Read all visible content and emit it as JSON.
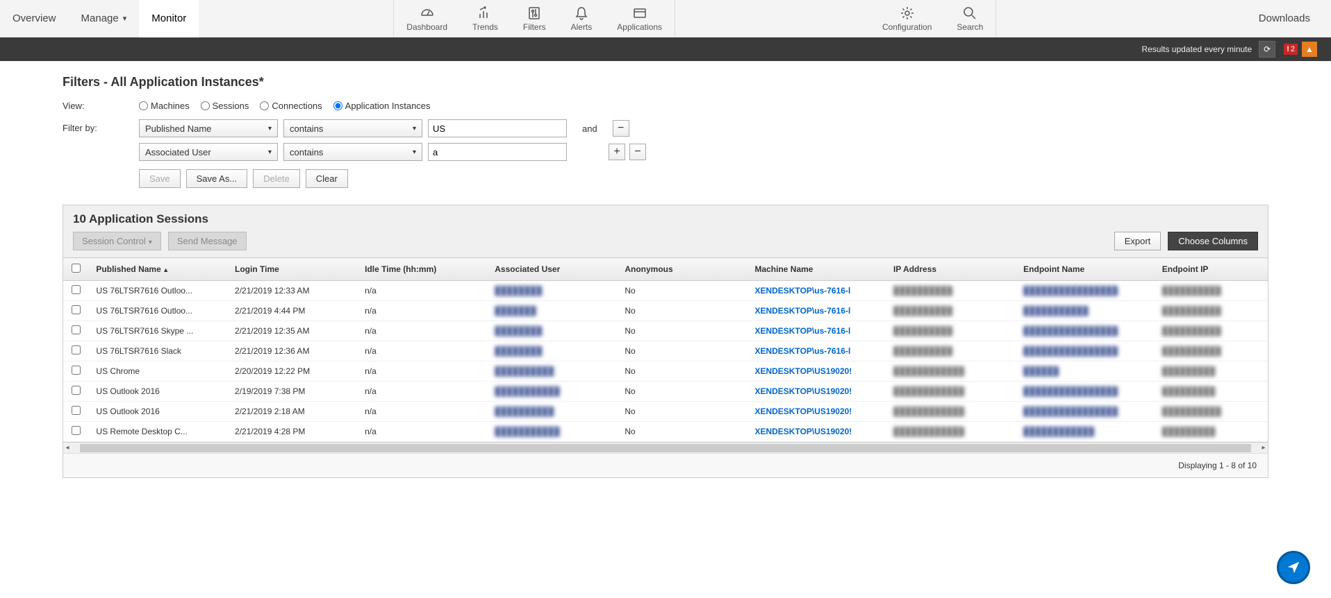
{
  "nav": {
    "overview": "Overview",
    "manage": "Manage",
    "monitor": "Monitor",
    "tools": {
      "dashboard": "Dashboard",
      "trends": "Trends",
      "filters": "Filters",
      "alerts": "Alerts",
      "applications": "Applications",
      "configuration": "Configuration",
      "search": "Search"
    },
    "downloads": "Downloads"
  },
  "darkbar": {
    "status": "Results updated every minute",
    "badge_count": "2"
  },
  "page": {
    "title": "Filters - All Application Instances*",
    "view_label": "View:",
    "radios": {
      "machines": "Machines",
      "sessions": "Sessions",
      "connections": "Connections",
      "app_instances": "Application Instances"
    },
    "filter_by_label": "Filter by:",
    "filters": [
      {
        "field": "Published Name",
        "op": "contains",
        "value": "US"
      },
      {
        "field": "Associated User",
        "op": "contains",
        "value": "a"
      }
    ],
    "and_label": "and",
    "buttons": {
      "save": "Save",
      "save_as": "Save As...",
      "delete": "Delete",
      "clear": "Clear"
    }
  },
  "results": {
    "title": "10 Application Sessions",
    "session_control": "Session Control",
    "send_message": "Send Message",
    "export": "Export",
    "choose_columns": "Choose Columns",
    "columns": [
      "Published Name",
      "Login Time",
      "Idle Time (hh:mm)",
      "Associated User",
      "Anonymous",
      "Machine Name",
      "IP Address",
      "Endpoint Name",
      "Endpoint IP"
    ],
    "rows": [
      {
        "pn": "US 76LTSR7616 Outloo...",
        "login": "2/21/2019 12:33 AM",
        "idle": "n/a",
        "user": "████████",
        "anon": "No",
        "machine": "XENDESKTOP\\us-7616-l",
        "ip": "██████████",
        "ep": "████████████████",
        "epip": "██████████"
      },
      {
        "pn": "US 76LTSR7616 Outloo...",
        "login": "2/21/2019 4:44 PM",
        "idle": "n/a",
        "user": "███████",
        "anon": "No",
        "machine": "XENDESKTOP\\us-7616-l",
        "ip": "██████████",
        "ep": "███████████",
        "epip": "██████████"
      },
      {
        "pn": "US 76LTSR7616 Skype ...",
        "login": "2/21/2019 12:35 AM",
        "idle": "n/a",
        "user": "████████",
        "anon": "No",
        "machine": "XENDESKTOP\\us-7616-l",
        "ip": "██████████",
        "ep": "████████████████",
        "epip": "██████████"
      },
      {
        "pn": "US 76LTSR7616 Slack",
        "login": "2/21/2019 12:36 AM",
        "idle": "n/a",
        "user": "████████",
        "anon": "No",
        "machine": "XENDESKTOP\\us-7616-l",
        "ip": "██████████",
        "ep": "████████████████",
        "epip": "██████████"
      },
      {
        "pn": "US Chrome",
        "login": "2/20/2019 12:22 PM",
        "idle": "n/a",
        "user": "██████████",
        "anon": "No",
        "machine": "XENDESKTOP\\US19020!",
        "ip": "████████████",
        "ep": "██████",
        "epip": "█████████"
      },
      {
        "pn": "US Outlook 2016",
        "login": "2/19/2019 7:38 PM",
        "idle": "n/a",
        "user": "███████████",
        "anon": "No",
        "machine": "XENDESKTOP\\US19020!",
        "ip": "████████████",
        "ep": "████████████████",
        "epip": "█████████"
      },
      {
        "pn": "US Outlook 2016",
        "login": "2/21/2019 2:18 AM",
        "idle": "n/a",
        "user": "██████████",
        "anon": "No",
        "machine": "XENDESKTOP\\US19020!",
        "ip": "████████████",
        "ep": "████████████████",
        "epip": "██████████"
      },
      {
        "pn": "US Remote Desktop C...",
        "login": "2/21/2019 4:28 PM",
        "idle": "n/a",
        "user": "███████████",
        "anon": "No",
        "machine": "XENDESKTOP\\US19020!",
        "ip": "████████████",
        "ep": "████████████",
        "epip": "█████████"
      }
    ],
    "footer": "Displaying 1 - 8 of 10"
  }
}
